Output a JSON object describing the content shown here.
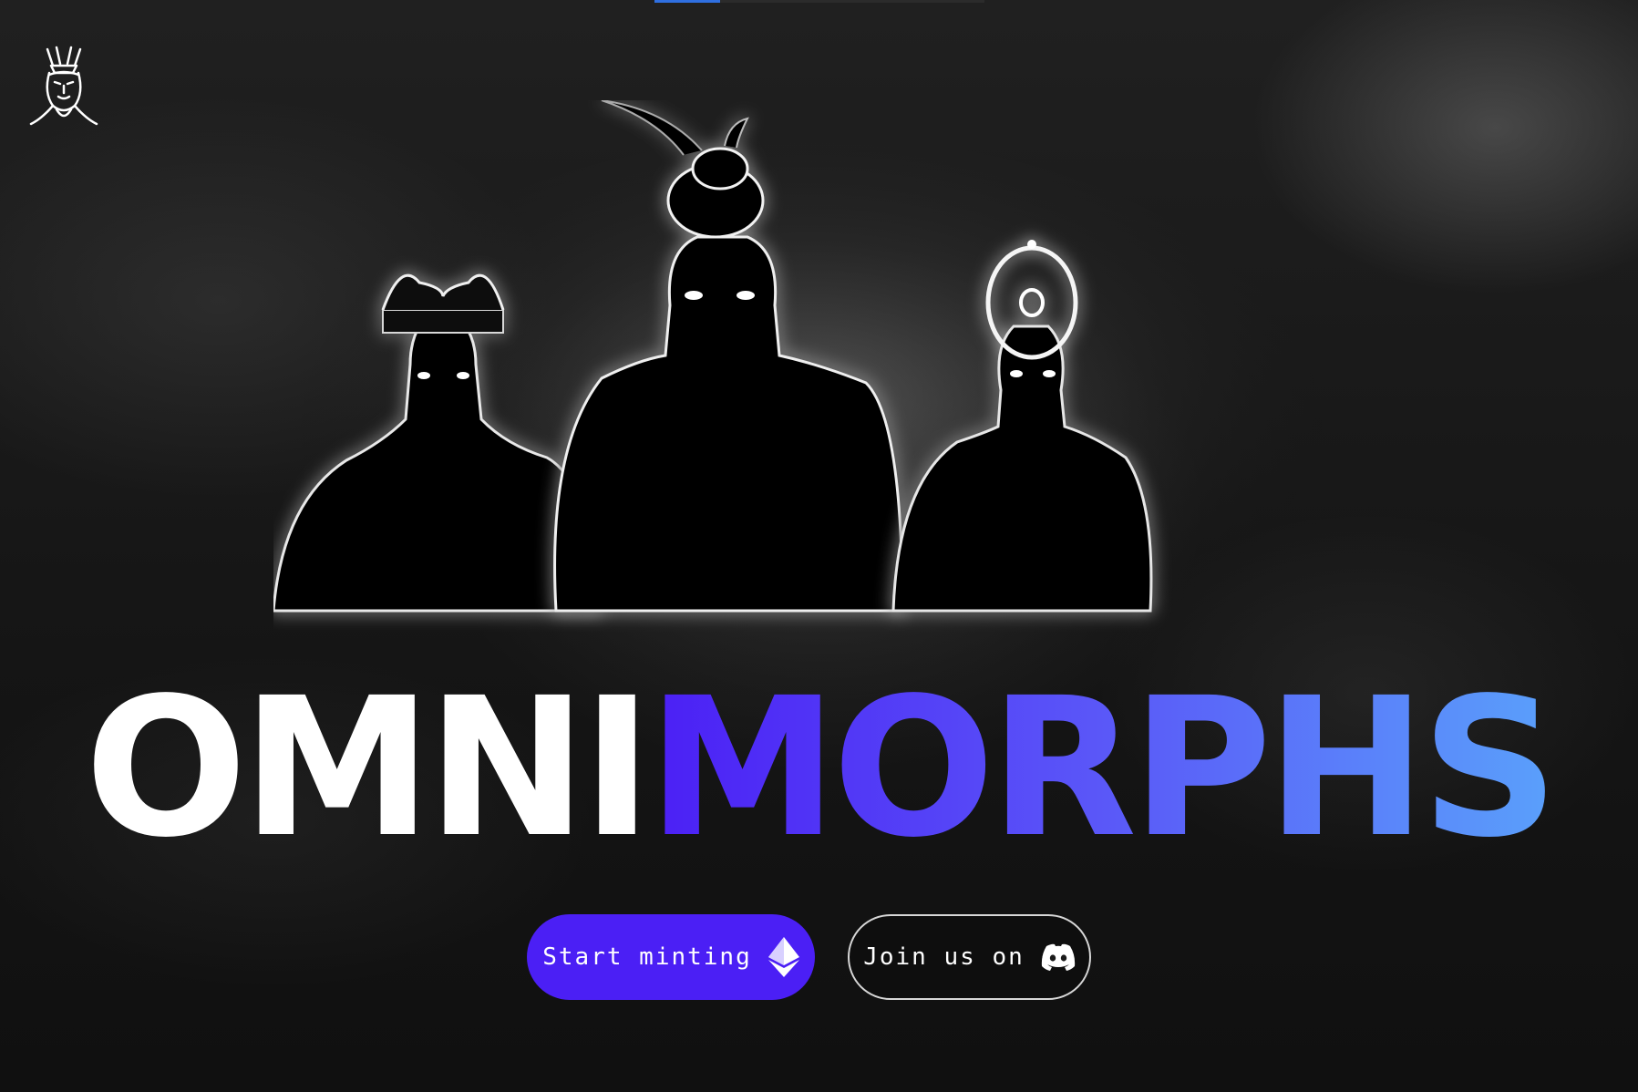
{
  "page": {
    "brand_title_part1": "OMNI",
    "brand_title_part2": "MORPHS",
    "accent_color": "#4b1ff5",
    "gradient_colors": [
      "#4b1ff5",
      "#5aa0fb"
    ]
  },
  "loading_bar": {
    "progress": 0.2
  },
  "buttons": {
    "mint_label": "Start minting",
    "mint_icon": "ethereum-icon",
    "discord_label": "Join us on",
    "discord_icon": "discord-icon"
  },
  "logo": {
    "icon": "mask-logo-icon"
  },
  "hero": {
    "image": "three-glowing-silhouette-characters"
  }
}
